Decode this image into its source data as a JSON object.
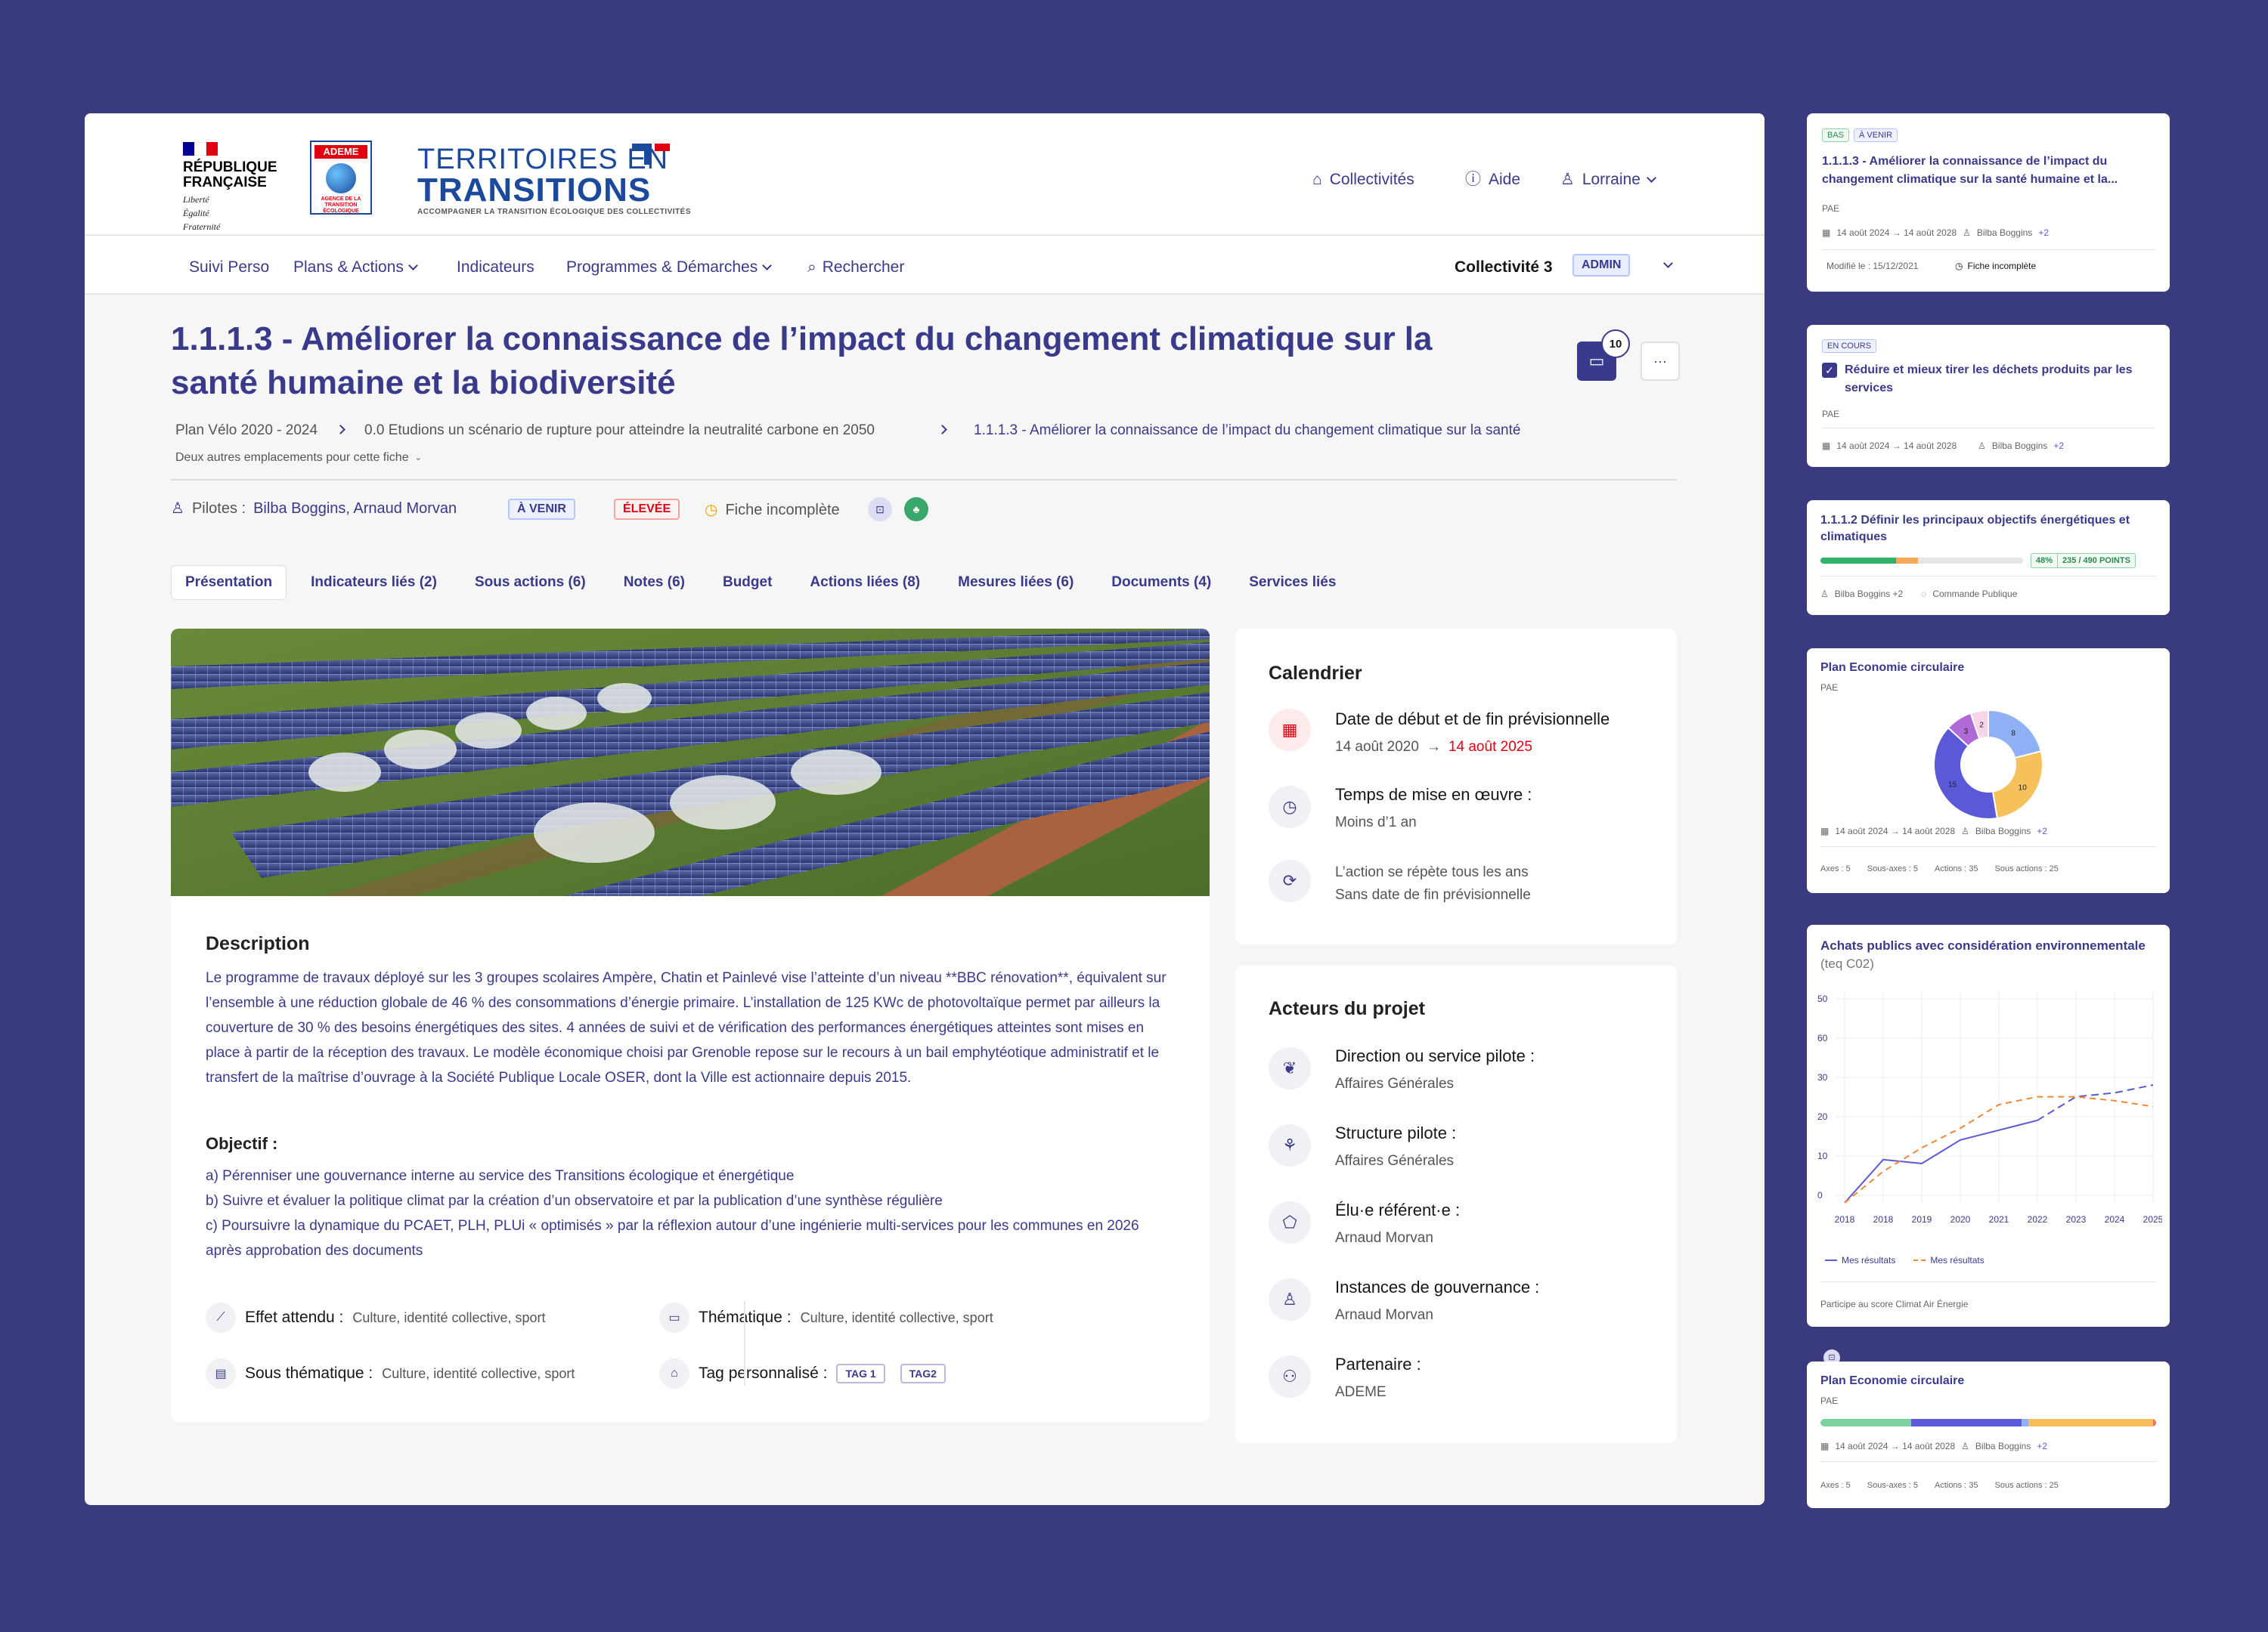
{
  "header": {
    "republique": [
      "RÉPUBLIQUE",
      "FRANÇAISE"
    ],
    "devise": [
      "Liberté",
      "Égalité",
      "Fraternité"
    ],
    "ademe": "ADEME",
    "ademe_sub": "AGENCE DE LA TRANSITION ÉCOLOGIQUE",
    "logo_line1": "TERRITOIRES EN",
    "logo_line2": "TRANSITIONS",
    "logo_line3": "ACCOMPAGNER LA TRANSITION ÉCOLOGIQUE DES COLLECTIVITÉS",
    "links": {
      "collectivites": "Collectivités",
      "aide": "Aide",
      "user": "Lorraine"
    }
  },
  "nav": {
    "items": [
      "Suivi Perso",
      "Plans & Actions",
      "Indicateurs",
      "Programmes & Démarches"
    ],
    "search": "Rechercher",
    "collectivite": "Collectivité 3",
    "role": "ADMIN"
  },
  "page": {
    "title": "1.1.1.3 - Améliorer la connaissance de l’impact du changement climatique sur la santé humaine et la biodiversité",
    "comments_count": "10",
    "more": "···",
    "breadcrumb": [
      "Plan Vélo 2020 - 2024",
      "0.0 Etudions un scénario de rupture pour atteindre la neutralité carbone en 2050",
      "1.1.1.3 - Améliorer la connaissance de l’impact du changement climatique sur la santé"
    ],
    "other_locations": "Deux autres emplacements pour cette fiche",
    "pilotes_label": "Pilotes :",
    "pilotes": "Bilba Boggins, Arnaud Morvan",
    "status": "À VENIR",
    "priority": "ÉLEVÉE",
    "incomplete": "Fiche incomplète"
  },
  "tabs": [
    "Présentation",
    "Indicateurs liés (2)",
    "Sous actions (6)",
    "Notes (6)",
    "Budget",
    "Actions liées (8)",
    "Mesures liées (6)",
    "Documents (4)",
    "Services liés"
  ],
  "description": {
    "title": "Description",
    "text": "Le programme de travaux déployé sur les 3 groupes scolaires Ampère, Chatin et Painlevé vise l’atteinte d’un niveau **BBC rénovation**, équivalent sur l’ensemble à une réduction globale de 46 % des consommations d’énergie primaire. L’installation de 125 KWc de photovoltaïque permet par ailleurs la couverture de 30 % des besoins énergétiques des sites. 4 années de suivi et de vérification des performances énergétiques atteintes sont mises en place à partir de la réception des travaux. Le modèle économique choisi par Grenoble repose sur le recours à un bail emphytéotique administratif et le transfert de la maîtrise d’ouvrage à la Société Publique Locale OSER, dont la Ville est actionnaire depuis 2015.",
    "objectif_title": "Objectif :",
    "objectifs": [
      "a) Pérenniser une gouvernance interne au service des Transitions écologique et énergétique",
      "b) Suivre et évaluer la politique climat par la création d’un observatoire et par la publication d’une synthèse régulière",
      "c) Poursuivre la dynamique du PCAET, PLH, PLUi « optimisés » par la réflexion autour d’une ingénierie multi-services pour les communes en 2026 après approbation des documents"
    ],
    "effet_label": "Effet attendu :",
    "effet": "Culture, identité collective, sport",
    "thematique_label": "Thématique :",
    "thematique": "Culture, identité collective, sport",
    "sous_label": "Sous thématique :",
    "sous": "Culture, identité collective, sport",
    "tag_label": "Tag personnalisé :",
    "tags": [
      "TAG 1",
      "TAG2"
    ]
  },
  "calendar": {
    "title": "Calendrier",
    "dates_label": "Date de début et de fin prévisionnelle",
    "start": "14 août 2020",
    "end": "14 août 2025",
    "temps_label": "Temps de mise en œuvre :",
    "temps": "Moins d’1 an",
    "repeat1": "L’action se répète tous les ans",
    "repeat2": "Sans date de fin prévisionnelle"
  },
  "acteurs": {
    "title": "Acteurs du projet",
    "rows": [
      {
        "label": "Direction ou service pilote :",
        "value": "Affaires Générales"
      },
      {
        "label": "Structure pilote :",
        "value": "Affaires Générales"
      },
      {
        "label": "Élu·e référent·e :",
        "value": "Arnaud Morvan"
      },
      {
        "label": "Instances de gouvernance :",
        "value": "Arnaud Morvan"
      },
      {
        "label": "Partenaire :",
        "value": "ADEME"
      }
    ]
  },
  "side": {
    "c1": {
      "b1": "BAS",
      "b2": "À VENIR",
      "title": "1.1.1.3 - Améliorer la connaissance de l’impact du changement climatique sur la santé humaine et la...",
      "plan": "PAE",
      "dates": "14 août 2024 → 14 août 2028",
      "pilot": "Bilba Boggins",
      "plus": "+2",
      "modif": "Modifié le : 15/12/2021",
      "incomplete": "Fiche incomplète"
    },
    "c2": {
      "b1": "EN COURS",
      "title": "Réduire et mieux tirer les déchets produits par les services",
      "plan": "PAE",
      "dates": "14 août 2024 → 14 août 2028",
      "pilot": "Bilba Boggins",
      "plus": "+2"
    },
    "c3": {
      "title": "1.1.1.2 Définir les principaux objectifs énergétiques et climatiques",
      "pct": "48%",
      "pts": "235 / 490 POINTS",
      "pilot": "Bilba Boggins +2",
      "commande": "Commande Publique",
      "progress": 0.48
    },
    "c4": {
      "title": "Plan Economie circulaire",
      "plan": "PAE",
      "donut": [
        8,
        10,
        15,
        3,
        2
      ],
      "dates": "14 août 2024 → 14 août 2028",
      "pilot": "Bilba Boggins",
      "plus": "+2",
      "axes": "Axes : 5",
      "sous_axes": "Sous-axes : 5",
      "actions": "Actions : 35",
      "sous_actions": "Sous actions : 25"
    },
    "c5": {
      "title": "Achats publics avec considération environnementale",
      "unit": "(teq C02)",
      "legend1": "Mes résultats",
      "legend2": "Mes résultats",
      "footer": "Participe au score Climat Air Énergie"
    },
    "c6": {
      "title": "Plan Economie circulaire",
      "plan": "PAE",
      "dates": "14 août 2024 → 14 août 2028",
      "pilot": "Bilba Boggins",
      "plus": "+2",
      "axes": "Axes : 5",
      "sous_axes": "Sous-axes : 5",
      "actions": "Actions : 35",
      "sous_actions": "Sous actions : 25"
    }
  },
  "chart_data": {
    "type": "line",
    "title": "Achats publics avec considération environnementale",
    "x": [
      "2018",
      "2018",
      "2019",
      "2020",
      "2021",
      "2022",
      "2023",
      "2024",
      "2025"
    ],
    "ylim": [
      0,
      50
    ],
    "yticks": [
      "50",
      "60",
      "30",
      "20",
      "10",
      "0"
    ],
    "series": [
      {
        "name": "Mes résultats",
        "style": "solid-dashed",
        "color": "#5a5ad8",
        "values": [
          0,
          11,
          10,
          16,
          18.5,
          21,
          27,
          28,
          30
        ]
      },
      {
        "name": "Mes résultats",
        "style": "dashed",
        "color": "#f0883a",
        "values": [
          0,
          8,
          14,
          19,
          25,
          27,
          27,
          26,
          24.5
        ]
      }
    ]
  }
}
